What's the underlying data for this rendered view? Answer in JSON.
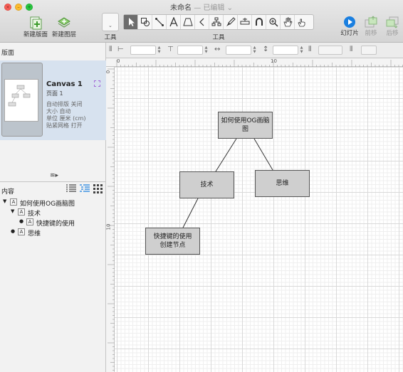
{
  "window": {
    "title": "未命名",
    "separator": "—",
    "status": "已编辑",
    "close_glyph": "×",
    "min_glyph": "–",
    "max_glyph": "+"
  },
  "toolbar": {
    "new_canvas_label": "新建版面",
    "new_layer_label": "新建图层",
    "style_tray_label": "工具",
    "tools_label": "工具",
    "slideshow_label": "幻灯片",
    "bring_front_label": "前移",
    "send_back_label": "后移",
    "tools": [
      "selection-arrow-icon",
      "shape-icon",
      "line-icon",
      "text-icon",
      "diagram-icon",
      "back-chevron-icon",
      "hierarchy-icon",
      "style-brush-icon",
      "magnet-icon",
      "magnet-u-icon",
      "zoom-icon",
      "hand-icon",
      "browse-hand-icon"
    ],
    "active_tool": "selection-arrow-icon"
  },
  "sidebar": {
    "canvases_header": "版面",
    "canvas": {
      "name": "Canvas 1",
      "page": "页面 1",
      "auto_layout": "自动排版 关闭",
      "size": "大小 自动",
      "units": "单位 厘米 (cm)",
      "snap_grid": "贴紧网格 打开"
    },
    "contents_header": "内容",
    "outline": [
      {
        "label": "如何使用OG画脑图",
        "level": 0,
        "marker": "▼"
      },
      {
        "label": "技术",
        "level": 1,
        "marker": "▼"
      },
      {
        "label": "快捷键的使用",
        "level": 2,
        "marker": "●"
      },
      {
        "label": "思维",
        "level": 1,
        "marker": "●"
      }
    ],
    "badge_letter": "A"
  },
  "ruler": {
    "top_labels": [
      "0",
      "10"
    ],
    "left_labels": [
      "0",
      "10"
    ]
  },
  "diagram": {
    "nodes": [
      {
        "id": "root",
        "label": "如何使用OG画脑图"
      },
      {
        "id": "tech",
        "label": "技术"
      },
      {
        "id": "think",
        "label": "思维"
      },
      {
        "id": "shortcut",
        "label": "快捷键的使用创建节点"
      }
    ],
    "edges": [
      [
        "root",
        "tech"
      ],
      [
        "root",
        "think"
      ],
      [
        "tech",
        "shortcut"
      ]
    ]
  },
  "colors": {
    "accent": "#1a7fe0",
    "node_fill": "#cfcfcf",
    "node_border": "#555555",
    "selection_bg": "#d7e2ef"
  }
}
